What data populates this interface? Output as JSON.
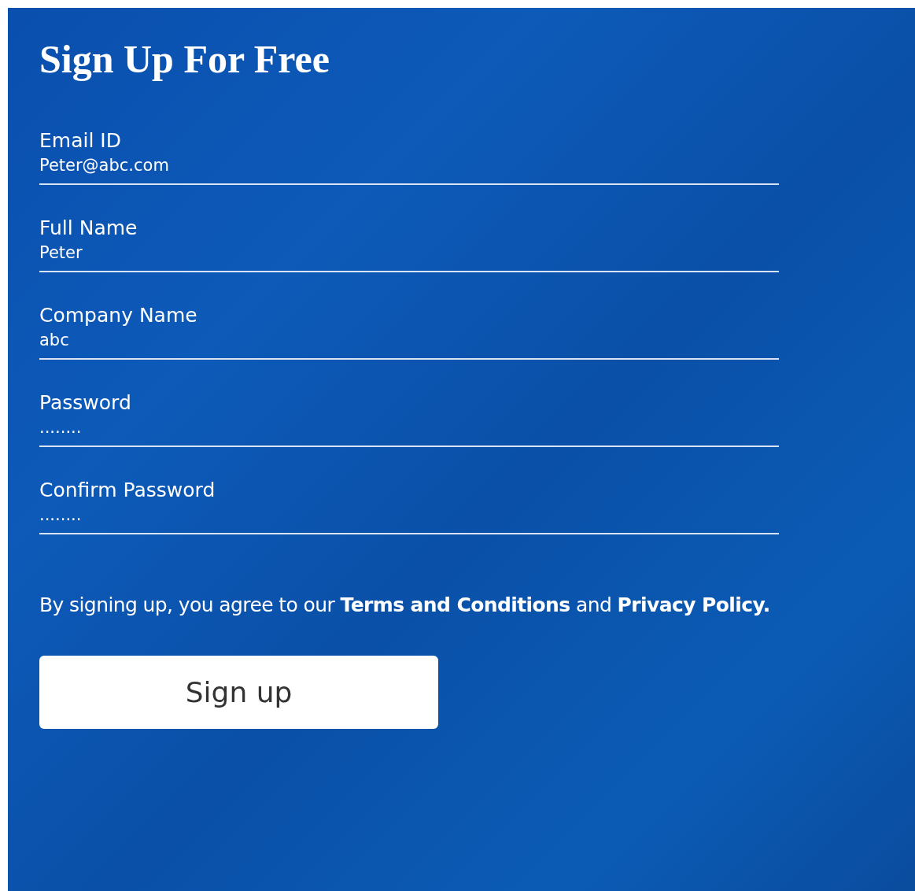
{
  "title": "Sign Up For Free",
  "fields": [
    {
      "label": "Email ID",
      "value": "Peter@abc.com"
    },
    {
      "label": "Full Name",
      "value": "Peter"
    },
    {
      "label": "Company Name",
      "value": "abc"
    },
    {
      "label": "Password",
      "value": "........"
    },
    {
      "label": "Confirm Password",
      "value": "........"
    }
  ],
  "agreement": {
    "text": "By signing up, you agree to our ",
    "terms_link": "Terms and Conditions",
    "joiner": " and ",
    "privacy_link": "Privacy Policy."
  },
  "submit_button": "Sign up"
}
